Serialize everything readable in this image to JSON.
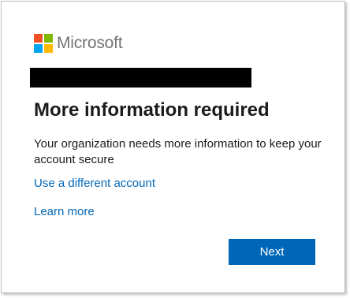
{
  "brand": {
    "name": "Microsoft",
    "logo_colors": [
      "#f25022",
      "#7fba00",
      "#00a4ef",
      "#ffb900"
    ]
  },
  "dialog": {
    "title": "More information required",
    "description": "Your organization needs more information to keep your account secure",
    "use_different_account_link": "Use a different account",
    "learn_more_link": "Learn more",
    "next_button": "Next"
  },
  "colors": {
    "accent": "#0067b8",
    "text": "#1b1b1b",
    "brand_text": "#737373"
  }
}
